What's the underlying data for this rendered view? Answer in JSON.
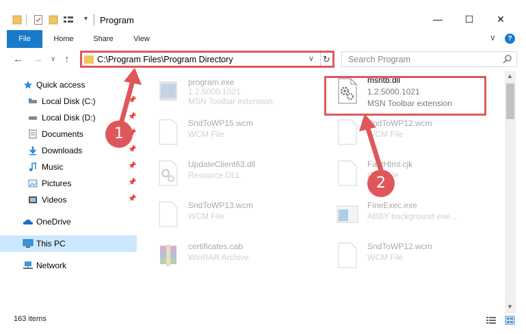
{
  "window": {
    "title": "Program",
    "minimize_glyph": "—",
    "maximize_glyph": "☐",
    "close_glyph": "✕"
  },
  "ribbon": {
    "tabs": [
      "File",
      "Home",
      "Share",
      "View"
    ],
    "help_label": "?",
    "chevron": "∨"
  },
  "navigation": {
    "back": "←",
    "forward": "→",
    "recent": "∨",
    "up": "↑"
  },
  "address": {
    "path": "C:\\Program Files\\Program Directory",
    "dropdown": "∨",
    "refresh": "↻"
  },
  "search": {
    "placeholder": "Search Program"
  },
  "sidebar": {
    "items": [
      {
        "label": "Quick access",
        "icon": "star-icon",
        "pinned": false
      },
      {
        "label": "Local Disk (C:)",
        "icon": "drive-icon",
        "pinned": true
      },
      {
        "label": "Local Disk (D:)",
        "icon": "drive-icon",
        "pinned": true
      },
      {
        "label": "Documents",
        "icon": "documents-icon",
        "pinned": true
      },
      {
        "label": "Downloads",
        "icon": "downloads-icon",
        "pinned": true
      },
      {
        "label": "Music",
        "icon": "music-icon",
        "pinned": true
      },
      {
        "label": "Pictures",
        "icon": "pictures-icon",
        "pinned": true
      },
      {
        "label": "Videos",
        "icon": "videos-icon",
        "pinned": true
      },
      {
        "label": "OneDrive",
        "icon": "cloud-icon",
        "pinned": false
      },
      {
        "label": "This PC",
        "icon": "computer-icon",
        "pinned": false,
        "selected": true
      },
      {
        "label": "Network",
        "icon": "network-icon",
        "pinned": false
      }
    ],
    "pin_glyph": "📌"
  },
  "files": [
    {
      "name": "program.exe",
      "line2": "1.2.5000.1021",
      "line3": "MSN Toolbar extension",
      "icon": "exe-icon",
      "faded": true
    },
    {
      "name": "msntb.dll",
      "line2": "1.2.5000.1021",
      "line3": "MSN Toolbar extension",
      "icon": "dll-gear-icon",
      "faded": false
    },
    {
      "name": "SndToWP15.wcm",
      "line2": "WCM File",
      "icon": "blank-file-icon",
      "faded": true
    },
    {
      "name": "SndToWP12.wcm",
      "line2": "WCM File",
      "icon": "blank-file-icon",
      "faded": true
    },
    {
      "name": "UpdateClient63.dll",
      "line2": "Resource DLL",
      "icon": "dll-gear-icon",
      "faded": true
    },
    {
      "name": "FastHtml.cjk",
      "line2": "CJK File",
      "icon": "blank-file-icon",
      "faded": true
    },
    {
      "name": "SndToWP13.wcm",
      "line2": "WCM File",
      "icon": "blank-file-icon",
      "faded": true
    },
    {
      "name": "FineExec.exe",
      "line2": "ABBY background exe...",
      "icon": "app-window-icon",
      "faded": true
    },
    {
      "name": "certificates.cab",
      "line2": "WinRAR Archive",
      "icon": "winrar-icon",
      "faded": true
    },
    {
      "name": "SndToWP12.wcm",
      "line2": "WCM File",
      "icon": "blank-file-icon",
      "faded": true
    }
  ],
  "status": {
    "item_count": "163 items"
  },
  "annotations": {
    "step1": "1",
    "step2": "2"
  },
  "colors": {
    "accent": "#1979ca",
    "annotation_red": "#e0575b",
    "selected_bg": "#cce8ff"
  }
}
